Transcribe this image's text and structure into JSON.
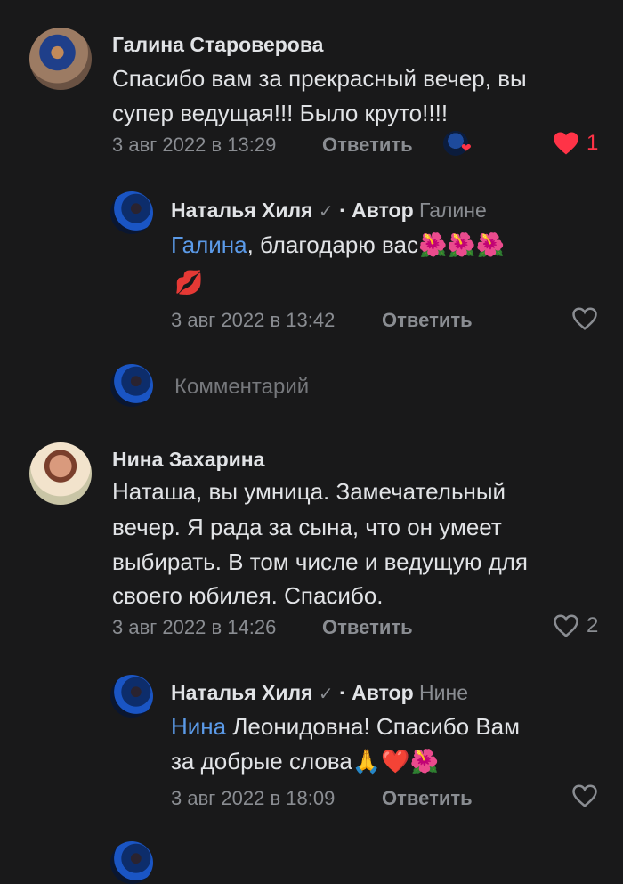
{
  "comments": [
    {
      "author": "Галина Староверова",
      "text_line1": "Спасибо вам за прекрасный вечер, вы",
      "text_line2": "супер ведущая!!! Было круто!!!!",
      "date": "3 авг 2022 в 13:29",
      "reply_label": "Ответить",
      "likes": "1",
      "reply": {
        "author": "Наталья Хиля",
        "verified": "✓",
        "author_tag": "· Автор",
        "reply_to": "Галине",
        "mention": "Галина",
        "text_line1": ", благодарю вас",
        "emoji_line1": "🌺🌺🌺",
        "emoji_line2": "💋",
        "date": "3 авг 2022 в 13:42",
        "reply_label": "Ответить"
      },
      "comment_placeholder": "Комментарий"
    },
    {
      "author": "Нина Захарина",
      "text_line1": "Наташа, вы умница. Замечательный",
      "text_line2": "вечер. Я рада за сына, что он умеет",
      "text_line3": "выбирать. В том числе и ведущую для",
      "text_line4": "своего юбилея. Спасибо.",
      "date": "3 авг 2022 в 14:26",
      "reply_label": "Ответить",
      "likes": "2",
      "reply": {
        "author": "Наталья Хиля",
        "verified": "✓",
        "author_tag": "· Автор",
        "reply_to": "Нине",
        "mention": "Нина",
        "text_line1": " Леонидовна! Спасибо Вам",
        "text_line2": "за добрые слова",
        "emoji_line2": "🙏❤️🌺",
        "date": "3 авг 2022 в 18:09",
        "reply_label": "Ответить"
      }
    }
  ],
  "colors": {
    "background": "#19191a",
    "text": "#e1e3e6",
    "secondary": "#8a8d92",
    "link": "#5b9ae8",
    "like_active": "#ff3347"
  }
}
